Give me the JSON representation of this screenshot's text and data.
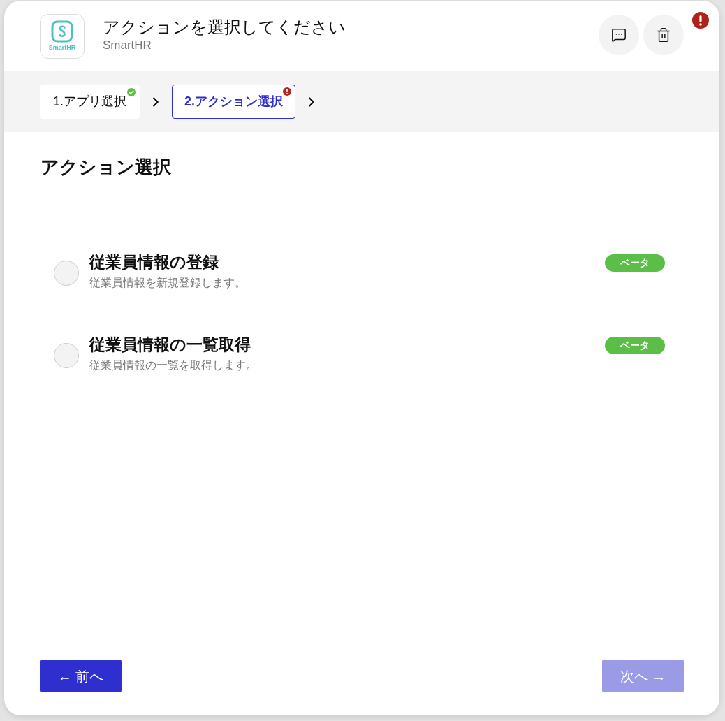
{
  "header": {
    "logo_text": "SmartHR",
    "title": "アクションを選択してください",
    "subtitle": "SmartHR",
    "alert": true
  },
  "steps": [
    {
      "label": "1.アプリ選択",
      "kind": "complete",
      "selected": false
    },
    {
      "label": "2.アクション選択",
      "kind": "error",
      "selected": true
    }
  ],
  "section_title": "アクション選択",
  "actions": [
    {
      "title": "従業員情報の登録",
      "description": "従業員情報を新規登録します。",
      "badge": "ベータ",
      "selected": false
    },
    {
      "title": "従業員情報の一覧取得",
      "description": "従業員情報の一覧を取得します。",
      "badge": "ベータ",
      "selected": false
    }
  ],
  "footer": {
    "buttons": [
      {
        "label": "← 前へ",
        "disabled": false
      },
      {
        "label": "次へ →",
        "disabled": true
      }
    ]
  }
}
